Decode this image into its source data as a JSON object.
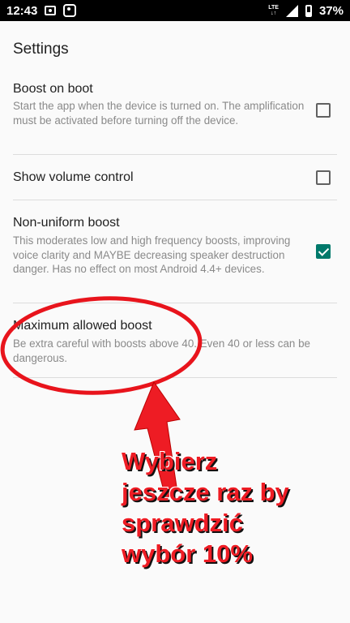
{
  "status_bar": {
    "time": "12:43",
    "network": "LTE",
    "battery": "37%"
  },
  "screen": {
    "title": "Settings"
  },
  "preferences": [
    {
      "title": "Boost on boot",
      "summary": "Start the app when the device is turned on. The amplification must be activated before turning off the device.",
      "checked": false
    },
    {
      "title": "Show volume control",
      "summary": "",
      "checked": false
    },
    {
      "title": "Non-uniform boost",
      "summary": "This moderates low and high frequency boosts, improving voice clarity and MAYBE decreasing speaker destruction danger. Has no effect on most Android 4.4+ devices.",
      "checked": true
    },
    {
      "title": "Maximum allowed boost",
      "summary": "Be extra careful with boosts above 40. Even 40 or less can be dangerous."
    }
  ],
  "annotation": {
    "lines": [
      "Wybierz",
      "jeszcze raz by",
      "sprawdzić",
      "wybór 10%"
    ],
    "color": "#ee1c24"
  },
  "colors": {
    "accent": "#00796b",
    "background": "#fafafa"
  }
}
